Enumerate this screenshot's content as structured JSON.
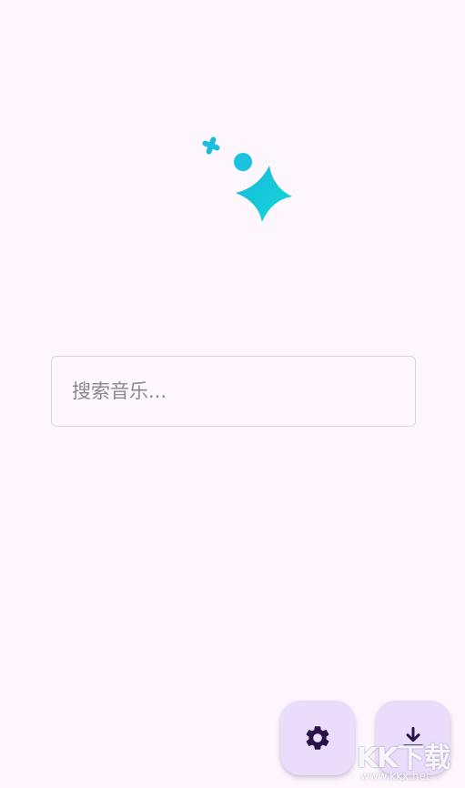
{
  "app": {
    "logo_icon": "sparkles-icon",
    "accent_color": "#1bc9dd"
  },
  "search": {
    "placeholder": "搜索音乐...",
    "value": ""
  },
  "actions": {
    "settings_icon": "gear-icon",
    "download_icon": "download-icon",
    "fab_color": "#eadcfb",
    "icon_color": "#2a1147"
  },
  "watermark": {
    "logo_text": "KK下载",
    "url": "www.kkx.net"
  }
}
